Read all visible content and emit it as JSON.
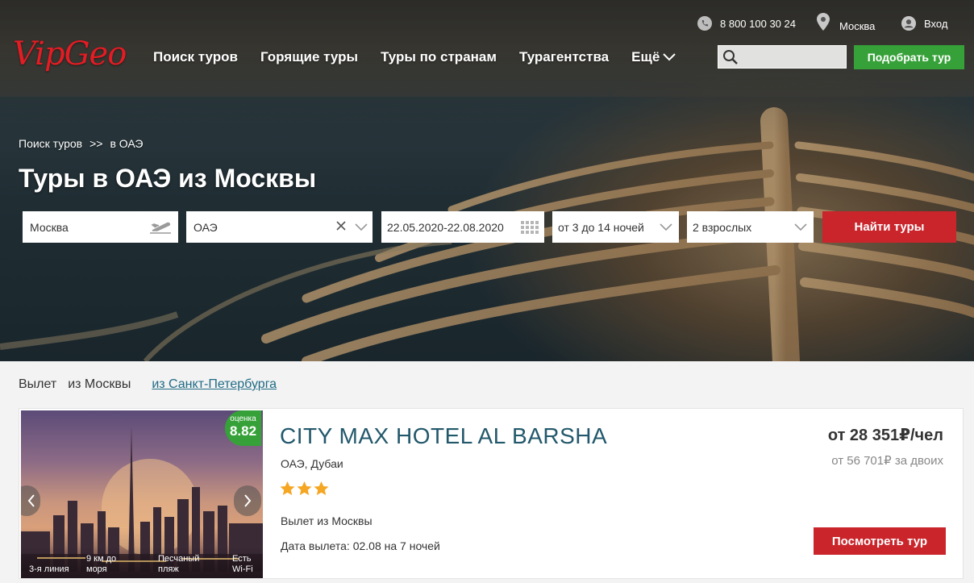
{
  "topbar": {
    "phone": "8 800 100 30 24",
    "city": "Москва",
    "login": "Вход"
  },
  "logo": "VipGeo",
  "nav": {
    "items": [
      "Поиск туров",
      "Горящие туры",
      "Туры по странам",
      "Турагентства"
    ],
    "more": "Ещё"
  },
  "search": {
    "placeholder": ""
  },
  "pick_tour_button": "Подобрать тур",
  "breadcrumb": {
    "root": "Поиск туров",
    "sep": ">>",
    "current": "в ОАЭ"
  },
  "page_title": "Туры в ОАЭ из Москвы",
  "search_form": {
    "from": "Москва",
    "to": "ОАЭ",
    "dates": "22.05.2020-22.08.2020",
    "nights": "от 3 до 14 ночей",
    "guests": "2 взрослых",
    "submit": "Найти туры"
  },
  "departure": {
    "label": "Вылет",
    "selected": "из Москвы",
    "other": "из Санкт-Петербурга"
  },
  "hotel": {
    "name": "CITY MAX HOTEL AL BARSHA",
    "location": "ОАЭ, Дубаи",
    "stars": 3,
    "rating_label": "оценка",
    "rating": "8.82",
    "flight": "Вылет из Москвы",
    "date": "Дата вылета: 02.08 на 7 ночей",
    "price": "от 28 351₽/чел",
    "price_two": "от 56 701₽ за двоих",
    "view_button": "Посмотреть тур",
    "features": [
      "3-я линия",
      "9 км до моря",
      "Песчаный пляж",
      "Есть Wi-Fi"
    ]
  },
  "colors": {
    "brand_red": "#e41c24",
    "green": "#37a139",
    "button_red": "#c9252b",
    "hotel_name": "#22586b",
    "link": "#1f6b85"
  }
}
